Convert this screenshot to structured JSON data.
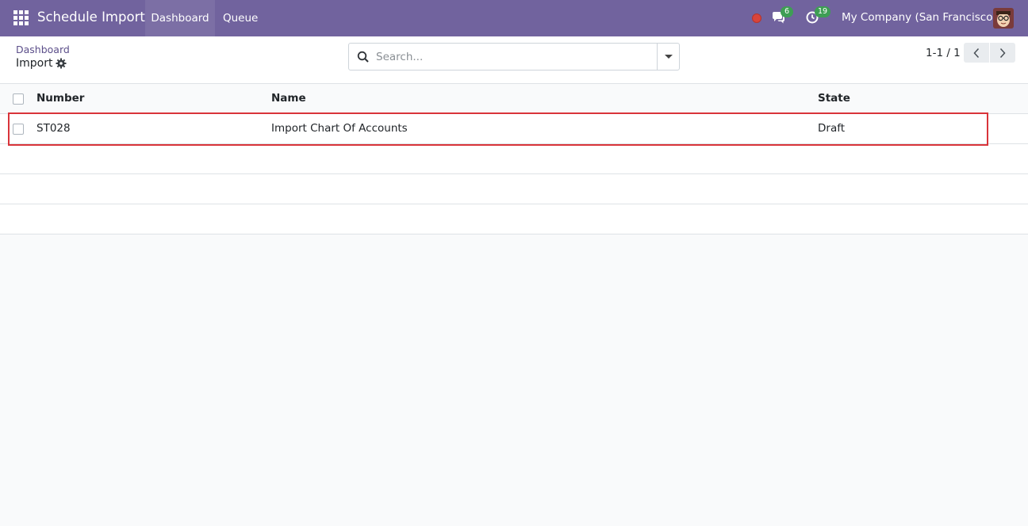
{
  "navbar": {
    "app_name": "Schedule Import",
    "menu": [
      "Dashboard",
      "Queue"
    ],
    "messages_count": "6",
    "activities_count": "19",
    "company": "My Company (San Francisco)",
    "brand_color": "#71639e",
    "badge_color": "#3e9e54",
    "record_dot_color": "#d9443a"
  },
  "control_panel": {
    "breadcrumb_parent": "Dashboard",
    "breadcrumb_current": "Import",
    "search_placeholder": "Search...",
    "pager_value": "1-1 / 1"
  },
  "table": {
    "columns": [
      "Number",
      "Name",
      "State"
    ],
    "rows": [
      {
        "number": "ST028",
        "name": "Import Chart Of Accounts",
        "state": "Draft"
      }
    ]
  },
  "icons": [
    "apps-grid-icon",
    "chat-icon",
    "activity-clock-icon",
    "gear-icon",
    "search-icon",
    "caret-down-icon",
    "chevron-left-icon",
    "chevron-right-icon"
  ]
}
